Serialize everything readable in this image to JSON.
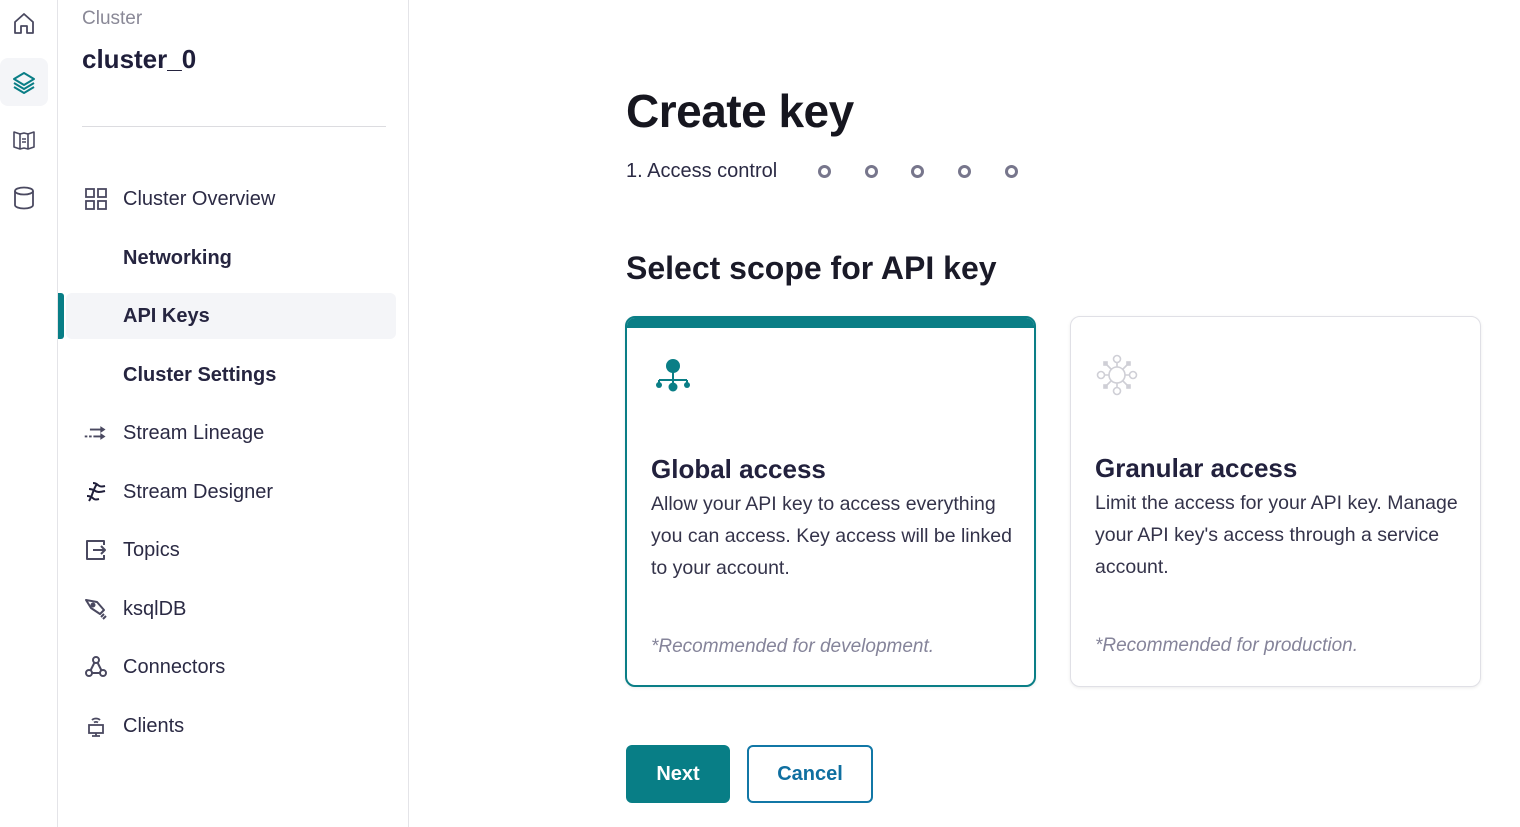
{
  "rail": {
    "items": [
      {
        "icon": "home-icon",
        "active": false
      },
      {
        "icon": "layers-icon",
        "active": true
      },
      {
        "icon": "map-icon",
        "active": false
      },
      {
        "icon": "database-icon",
        "active": false
      }
    ]
  },
  "nav": {
    "eyebrow": "Cluster",
    "cluster_name": "cluster_0",
    "items": [
      {
        "label": "Cluster Overview",
        "icon": "grid-icon"
      },
      {
        "label": "Networking",
        "sub": true
      },
      {
        "label": "API Keys",
        "sub": true,
        "active": true
      },
      {
        "label": "Cluster Settings",
        "sub": true
      },
      {
        "label": "Stream Lineage",
        "icon": "stream-lineage-icon"
      },
      {
        "label": "Stream Designer",
        "icon": "stream-designer-icon"
      },
      {
        "label": "Topics",
        "icon": "topics-icon"
      },
      {
        "label": "ksqlDB",
        "icon": "rocket-icon"
      },
      {
        "label": "Connectors",
        "icon": "connectors-icon"
      },
      {
        "label": "Clients",
        "icon": "clients-icon"
      }
    ]
  },
  "main": {
    "title": "Create key",
    "step": {
      "label": "1. Access control",
      "total_steps": 6,
      "current_step": 1
    },
    "section_title": "Select scope for API key",
    "cards": [
      {
        "title": "Global access",
        "description": "Allow your API key to access everything you can access. Key access will be linked to your account.",
        "note": "*Recommended for development.",
        "selected": true,
        "icon": "hierarchy-icon"
      },
      {
        "title": "Granular access",
        "description": "Limit the access for your API key. Manage your API key's access through a service account.",
        "note": "*Recommended for production.",
        "selected": false,
        "icon": "network-hub-icon"
      }
    ],
    "buttons": {
      "next": "Next",
      "cancel": "Cancel"
    }
  },
  "colors": {
    "accent": "#087e86",
    "link": "#1177a6",
    "text": "#1f1e3a",
    "muted": "#85849a"
  }
}
